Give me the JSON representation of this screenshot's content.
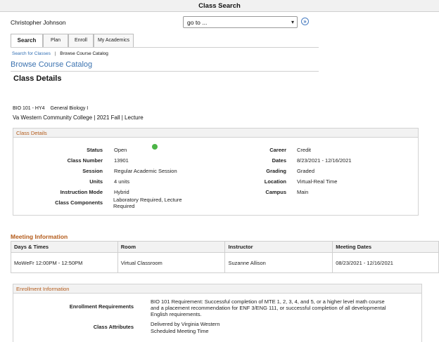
{
  "window": {
    "title": "Class Search"
  },
  "user": {
    "name": "Christopher Johnson"
  },
  "goto": {
    "selected": "go to ..."
  },
  "tabs": [
    {
      "label": "Search",
      "active": true
    },
    {
      "label": "Plan",
      "active": false
    },
    {
      "label": "Enroll",
      "active": false
    },
    {
      "label": "My Academics",
      "active": false
    }
  ],
  "breadcrumb": {
    "link": "Search for Classes",
    "separator": "|",
    "current": "Browse Course Catalog"
  },
  "page": {
    "heading": "Browse Course Catalog",
    "section_title": "Class Details"
  },
  "course": {
    "code": "BIO  101 - HY4",
    "name": "General Biology I",
    "info": "Va Western Community College | 2021 Fall | Lecture"
  },
  "class_details": {
    "title": "Class Details",
    "status_color": "#4cb547",
    "left": [
      {
        "label": "Status",
        "value": "Open"
      },
      {
        "label": "Class Number",
        "value": "13901"
      },
      {
        "label": "Session",
        "value": "Regular Academic Session"
      },
      {
        "label": "Units",
        "value": "4 units"
      },
      {
        "label": "Instruction Mode",
        "value": "Hybrid"
      },
      {
        "label": "Class Components",
        "value": "Laboratory Required, Lecture Required"
      }
    ],
    "right": [
      {
        "label": "Career",
        "value": "Credit"
      },
      {
        "label": "Dates",
        "value": "8/23/2021 - 12/16/2021"
      },
      {
        "label": "Grading",
        "value": "Graded"
      },
      {
        "label": "Location",
        "value": "Virtual-Real Time"
      },
      {
        "label": "Campus",
        "value": "Main"
      }
    ]
  },
  "meeting": {
    "title": "Meeting Information",
    "headers": [
      "Days & Times",
      "Room",
      "Instructor",
      "Meeting Dates"
    ],
    "rows": [
      [
        "MoWeFr 12:00PM - 12:50PM",
        "Virtual Classroom",
        "Suzanne Allison",
        "08/23/2021 - 12/16/2021"
      ]
    ]
  },
  "enrollment": {
    "title": "Enrollment Information",
    "requirements_label": "Enrollment Requirements",
    "requirements_value": "BIO 101 Requirement: Successful completion of MTE 1, 2, 3, 4, and 5, or a higher level math course and a placement recommendation for ENF 3/ENG 111, or successful completion of all developmental English requirements.",
    "attributes_label": "Class Attributes",
    "attributes_line1": "Delivered by Virginia Western",
    "attributes_line2": "Scheduled Meeting Time"
  }
}
